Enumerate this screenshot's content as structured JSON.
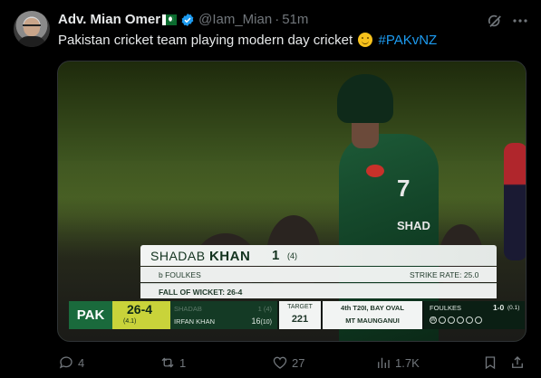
{
  "tweet": {
    "author_name": "Adv. Mian Omer",
    "handle": "@Iam_Mian",
    "separator": "·",
    "time": "51m",
    "text": "Pakistan cricket team playing modern day cricket",
    "hashtag": "#PAKvNZ"
  },
  "media": {
    "player_jersey_number": "7",
    "player_jersey_text": "SHAD",
    "lower_third": {
      "first_name": "SHADAB",
      "last_name": "KHAN",
      "runs": "1",
      "balls": "(4)",
      "dismissal": "b FOULKES",
      "strike_rate_label": "STRIKE RATE: 25.0",
      "fall_of_wicket": "FALL OF WICKET: 26-4"
    },
    "scorebug": {
      "team": "PAK",
      "score": "26-4",
      "overs": "(4.1)",
      "batter1_name": "SHADAB",
      "batter1_score": "1 (4)",
      "batter2_marker": "P",
      "batter2_name": "IRFAN KHAN",
      "batter2_score": "16",
      "batter2_balls": "(10)",
      "target_label": "TARGET",
      "target_value": "221",
      "match_line1": "4th T20I, BAY OVAL",
      "match_line2": "MT MAUNGANUI",
      "bowler_name": "FOULKES",
      "bowler_figures": "1-0",
      "bowler_overs": "(0.1)",
      "ball_marker": "W"
    }
  },
  "actions": {
    "replies": "4",
    "reposts": "1",
    "likes": "27",
    "views": "1.7K"
  },
  "colors": {
    "link": "#1d9bf0",
    "muted": "#71767b",
    "background": "#000000",
    "team_green": "#1a6a3c",
    "score_yellow": "#c9d33a"
  },
  "icons": [
    "verified-badge-icon",
    "grok-icon",
    "more-icon",
    "reply-icon",
    "repost-icon",
    "like-icon",
    "views-icon",
    "bookmark-icon",
    "share-icon"
  ]
}
